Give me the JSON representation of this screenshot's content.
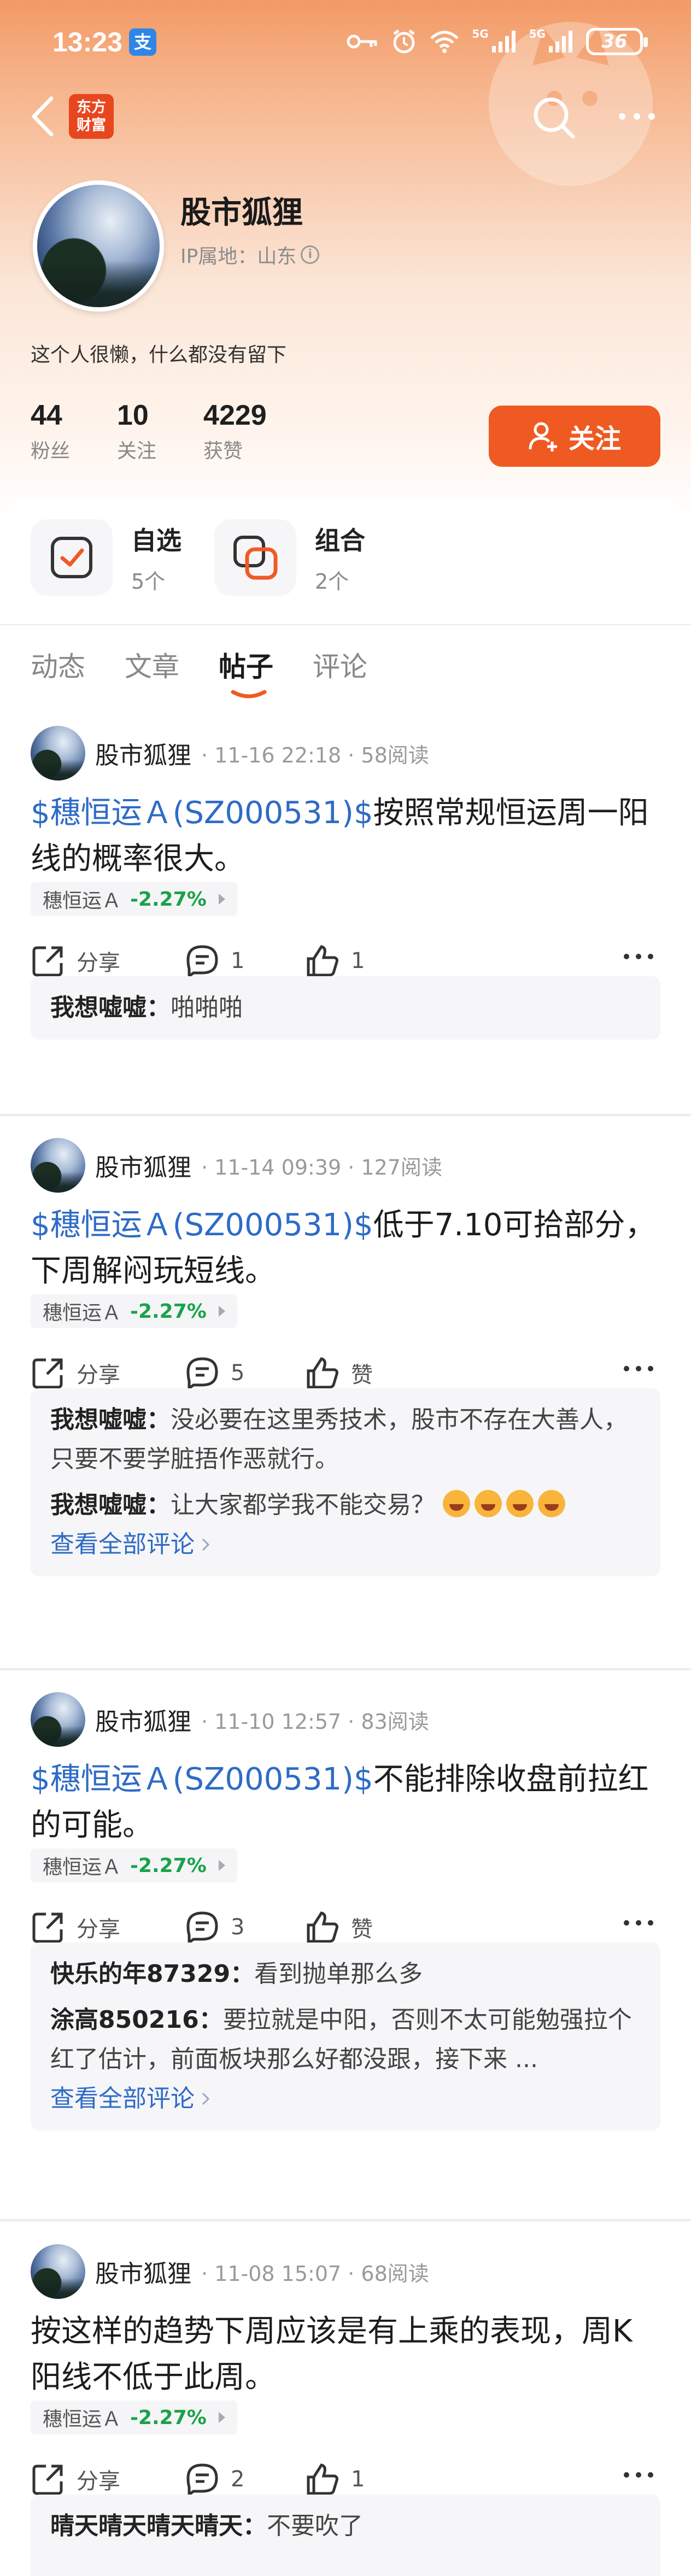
{
  "status_bar": {
    "time": "13:23",
    "alipay_badge": "支",
    "network_1": "5G",
    "network_2": "5G",
    "battery": "36"
  },
  "nav": {
    "logo_line1": "东方",
    "logo_line2": "财富"
  },
  "profile": {
    "name": "股市狐狸",
    "ip_location": "IP属地：山东",
    "bio": "这个人很懒，什么都没有留下",
    "stats": [
      {
        "value": "44",
        "label": "粉丝"
      },
      {
        "value": "10",
        "label": "关注"
      },
      {
        "value": "4229",
        "label": "获赞"
      }
    ],
    "follow_label": "关注"
  },
  "quick_entries": [
    {
      "title": "自选",
      "sub": "5个"
    },
    {
      "title": "组合",
      "sub": "2个"
    }
  ],
  "tabs": [
    "动态",
    "文章",
    "帖子",
    "评论"
  ],
  "colors": {
    "accent": "#ef5a23",
    "link": "#2e6bc6",
    "down": "#18a34a"
  },
  "posts": [
    {
      "author": "股市狐狸",
      "meta": "· 11-16 22:18 · 58阅读",
      "stock_link": "$穗恒运Ａ(SZ000531)$",
      "text": "按照常规恒运周一阳线的概率很大。",
      "tag_name": "穗恒运Ａ",
      "tag_change": "-2.27%",
      "share": "分享",
      "comment_count": "1",
      "like": "1",
      "comments": [
        {
          "user": "我想嘘嘘：",
          "text": "啪啪啪"
        }
      ],
      "view_all": ""
    },
    {
      "author": "股市狐狸",
      "meta": "· 11-14 09:39 · 127阅读",
      "stock_link": "$穗恒运Ａ(SZ000531)$",
      "text": "低于7.10可拾部分，下周解闷玩短线。",
      "tag_name": "穗恒运Ａ",
      "tag_change": "-2.27%",
      "share": "分享",
      "comment_count": "5",
      "like": "赞",
      "comments": [
        {
          "user": "我想嘘嘘：",
          "text": "没必要在这里秀技术，股市不存在大善人，只要不要学脏捂作恶就行。"
        },
        {
          "user": "我想嘘嘘：",
          "text": "让大家都学我不能交易？"
        }
      ],
      "view_all": "查看全部评论"
    },
    {
      "author": "股市狐狸",
      "meta": "· 11-10 12:57 · 83阅读",
      "stock_link": "$穗恒运Ａ(SZ000531)$",
      "text": "不能排除收盘前拉红的可能。",
      "tag_name": "穗恒运Ａ",
      "tag_change": "-2.27%",
      "share": "分享",
      "comment_count": "3",
      "like": "赞",
      "comments": [
        {
          "user": "快乐的年87329：",
          "text": "看到抛单那么多"
        },
        {
          "user": "涂高850216：",
          "text": "要拉就是中阳，否则不太可能勉强拉个红了估计，前面板块那么好都没跟，接下来 ..."
        }
      ],
      "view_all": "查看全部评论"
    },
    {
      "author": "股市狐狸",
      "meta": "· 11-08 15:07 · 68阅读",
      "stock_link": "",
      "text": "按这样的趋势下周应该是有上乘的表现，周K阳线不低于此周。",
      "tag_name": "穗恒运Ａ",
      "tag_change": "-2.27%",
      "share": "分享",
      "comment_count": "2",
      "like": "1",
      "comments": [
        {
          "user": "晴天晴天晴天晴天：",
          "text": "不要吹了"
        }
      ],
      "view_all": ""
    }
  ]
}
